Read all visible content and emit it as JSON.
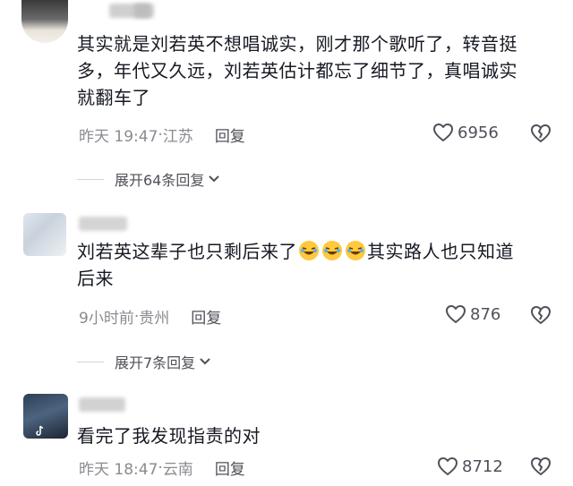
{
  "comments": [
    {
      "text_line1": "其实就是刘若英不想唱诚实，刚才那个歌听了，转音挺",
      "text_line2": "多，年代又久远，刘若英估计都忘了细节了，真唱诚实",
      "text_line3": "就翻车了",
      "time": "昨天 19:47",
      "location": "江苏",
      "reply_label": "回复",
      "likes": "6956",
      "expand_label": "展开64条回复"
    },
    {
      "text_part1": "刘若英这辈子也只剩后来了",
      "text_part2": "其实路人也只知道",
      "text_line2": "后来",
      "time": "9小时前",
      "location": "贵州",
      "reply_label": "回复",
      "likes": "876",
      "expand_label": "展开7条回复"
    },
    {
      "text_line1": "看完了我发现指责的对",
      "time": "昨天 18:47",
      "location": "云南",
      "reply_label": "回复",
      "likes": "8712"
    }
  ],
  "meta_separator": "·",
  "icons": {
    "like": "heart-outline-icon",
    "dislike": "broken-heart-icon",
    "expand": "chevron-down-icon",
    "emoji": "rolling-laughing-emoji",
    "tiktok": "tiktok-logo-icon"
  },
  "colors": {
    "text": "#161823",
    "meta": "#8a8b91",
    "secondary": "#4f5059",
    "emoji_face": "#ffc83d"
  }
}
